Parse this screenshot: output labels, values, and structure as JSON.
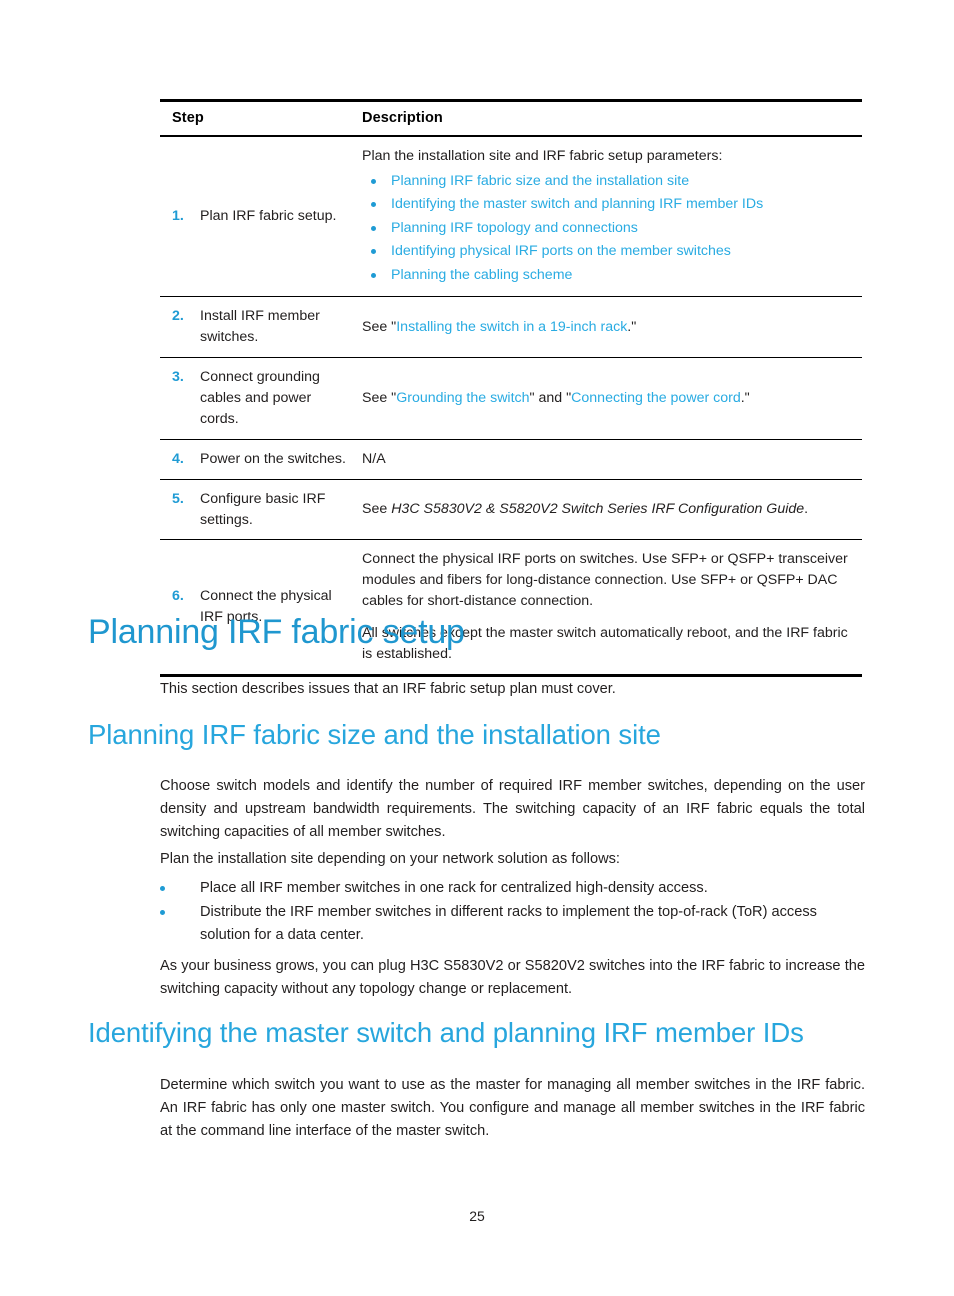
{
  "document": {
    "page_number": "25",
    "colors": {
      "link_blue": "#29abe2",
      "heading_blue_h1": "#1f97cf",
      "heading_blue_h2": "#27a6dd",
      "step_number_blue": "#1f9bd4",
      "body_text": "#221f1f",
      "rule_black": "#000000"
    }
  },
  "table": {
    "headers": {
      "step": "Step",
      "description": "Description"
    },
    "rows": [
      {
        "number": "1.",
        "label": "Plan IRF fabric setup.",
        "intro": "Plan the installation site and IRF fabric setup parameters:",
        "links": [
          "Planning IRF fabric size and the installation site",
          "Identifying the master switch and planning IRF member IDs",
          "Planning IRF topology and connections",
          "Identifying physical IRF ports on the member switches",
          "Planning the cabling scheme"
        ]
      },
      {
        "number": "2.",
        "label": "Install IRF member switches.",
        "see_prefix": "See \"",
        "link1": "Installing the switch in a 19-inch rack",
        "see_suffix": ".\""
      },
      {
        "number": "3.",
        "label": "Connect grounding cables and power cords.",
        "see_prefix": "See \"",
        "link1": "Grounding the switch",
        "see_middle": "\" and \"",
        "link2": "Connecting the power cord",
        "see_suffix": ".\""
      },
      {
        "number": "4.",
        "label": "Power on the switches.",
        "description": "N/A"
      },
      {
        "number": "5.",
        "label": "Configure basic IRF settings.",
        "see_prefix": "See ",
        "reference_italic": "H3C S5830V2 & S5820V2 Switch Series IRF Configuration Guide",
        "see_suffix": "."
      },
      {
        "number": "6.",
        "label": "Connect the physical IRF ports.",
        "paragraph1": "Connect the physical IRF ports on switches. Use SFP+ or QSFP+ transceiver modules and fibers for long-distance connection. Use SFP+ or QSFP+ DAC cables for short-distance connection.",
        "paragraph2": "All switches except the master switch automatically reboot, and the IRF fabric is established."
      }
    ]
  },
  "sections": {
    "planning_irf_fabric_setup": {
      "heading": "Planning IRF fabric setup",
      "paragraph": "This section describes issues that an IRF fabric setup plan must cover."
    },
    "planning_irf_fabric_size": {
      "heading": "Planning IRF fabric size and the installation site",
      "paragraph1": "Choose switch models and identify the number of required IRF member switches, depending on the user density and upstream bandwidth requirements. The switching capacity of an IRF fabric equals the total switching capacities of all member switches.",
      "paragraph2": "Plan the installation site depending on your network solution as follows:",
      "bullets": [
        "Place all IRF member switches in one rack for centralized high-density access.",
        "Distribute the IRF member switches in different racks to implement the top-of-rack (ToR) access solution for a data center."
      ],
      "paragraph3": "As your business grows, you can plug H3C S5830V2 or S5820V2 switches into the IRF fabric to increase the switching capacity without any topology change or replacement."
    },
    "identifying_master_switch": {
      "heading": "Identifying the master switch and planning IRF member IDs",
      "paragraph1": "Determine which switch you want to use as the master for managing all member switches in the IRF fabric. An IRF fabric has only one master switch. You configure and manage all member switches in the IRF fabric at the command line interface of the master switch."
    }
  }
}
